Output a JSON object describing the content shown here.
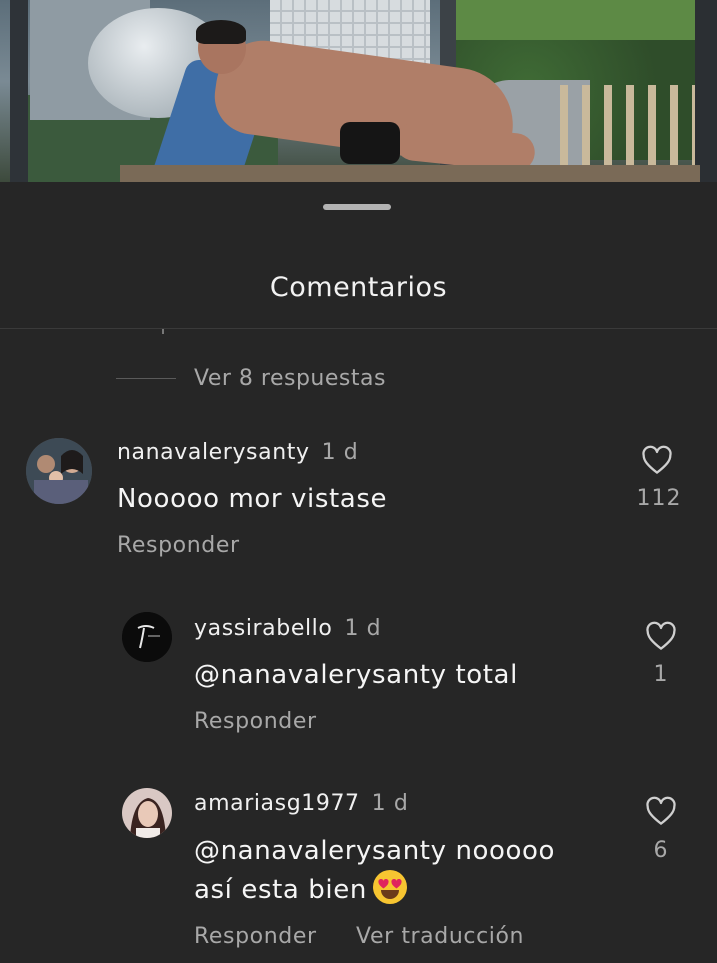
{
  "sheet": {
    "title": "Comentarios"
  },
  "view_replies_label": "Ver 8 respuestas",
  "comments": [
    {
      "username": "nanavalerysanty",
      "time": "1 d",
      "text": "Nooooo mor vistase",
      "likes": "112",
      "reply_label": "Responder"
    },
    {
      "username": "yassirabello",
      "time": "1 d",
      "text": "@nanavalerysanty total",
      "likes": "1",
      "reply_label": "Responder"
    },
    {
      "username": "amariasg1977",
      "time": "1 d",
      "text_line1": "@nanavalerysanty nooooo",
      "text_line2": "así esta bien",
      "emoji": "heart-eyes-emoji",
      "likes": "6",
      "reply_label": "Responder",
      "translate_label": "Ver traducción"
    }
  ],
  "colors": {
    "background": "#262626",
    "primary_text": "#f5f5f5",
    "secondary_text": "#a8a8a8"
  }
}
